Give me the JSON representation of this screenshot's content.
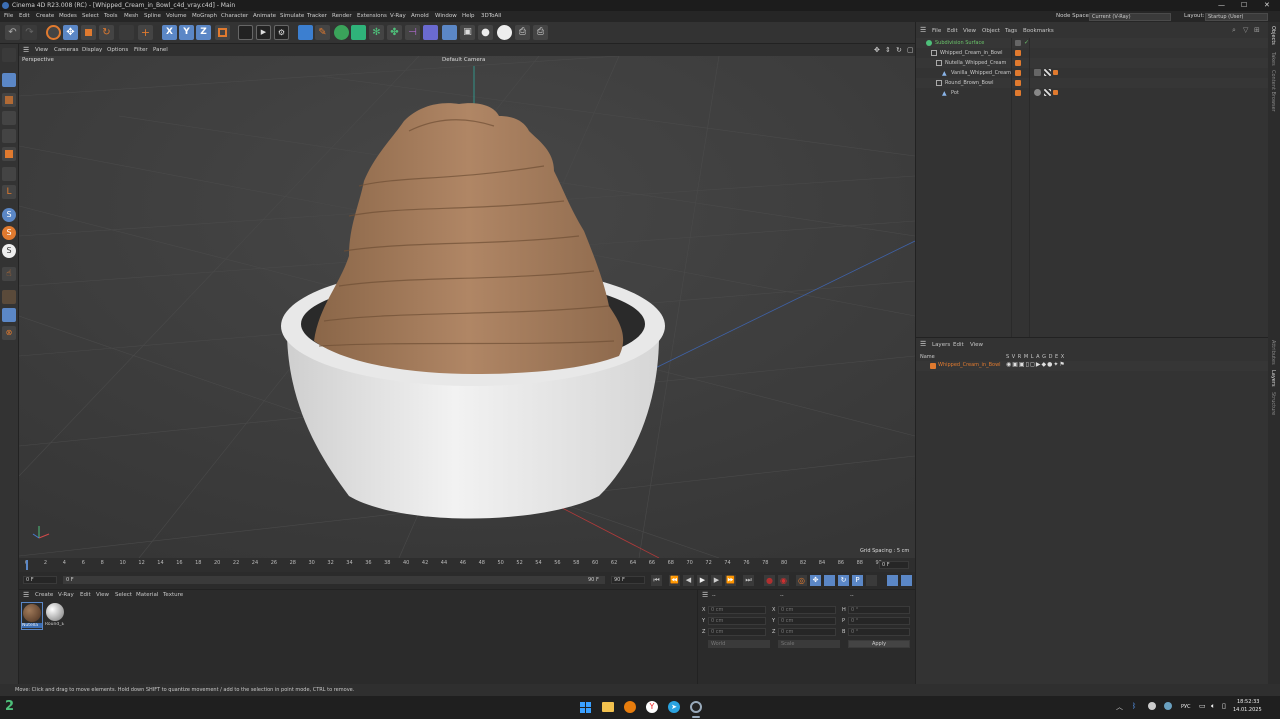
{
  "title_bar": {
    "title": "Cinema 4D R23.008 (RC) - [Whipped_Cream_in_Bowl_c4d_vray.c4d] - Main",
    "min": "—",
    "max": "☐",
    "close": "✕"
  },
  "menu": [
    "File",
    "Edit",
    "Create",
    "Modes",
    "Select",
    "Tools",
    "Mesh",
    "Spline",
    "Volume",
    "MoGraph",
    "Character",
    "Animate",
    "Simulate",
    "Tracker",
    "Render",
    "Extensions",
    "V-Ray",
    "Arnold",
    "Window",
    "Help",
    "3DToAll"
  ],
  "node_space": {
    "label": "Node Space:",
    "value": "Current (V-Ray)"
  },
  "layout": {
    "label": "Layout:",
    "value": "Startup (User)"
  },
  "viewport_menu": [
    "View",
    "Cameras",
    "Display",
    "Options",
    "Filter",
    "Panel"
  ],
  "viewport": {
    "name": "Perspective",
    "camera": "Default Camera",
    "grid_spacing": "Grid Spacing : 5 cm"
  },
  "timeline": {
    "ticks": [
      "0",
      "2",
      "4",
      "6",
      "8",
      "10",
      "12",
      "14",
      "16",
      "18",
      "20",
      "22",
      "24",
      "26",
      "28",
      "30",
      "32",
      "34",
      "36",
      "38",
      "40",
      "42",
      "44",
      "46",
      "48",
      "50",
      "52",
      "54",
      "56",
      "58",
      "60",
      "62",
      "64",
      "66",
      "68",
      "70",
      "72",
      "74",
      "76",
      "78",
      "80",
      "82",
      "84",
      "86",
      "88",
      "90"
    ],
    "current_frame": "0 F"
  },
  "transport": {
    "start": "0 F",
    "preview_start": "0 F",
    "preview_end": "90 F",
    "end": "90 F"
  },
  "material_manager": {
    "menu": [
      "Create",
      "V-Ray",
      "Edit",
      "View",
      "Select",
      "Material",
      "Texture"
    ],
    "materials": [
      {
        "name": "Nutella",
        "color": "#7a5a3e"
      },
      {
        "name": "Round_E",
        "color": "#cfcfcf"
      }
    ]
  },
  "coordinates": {
    "header": "--",
    "header2": "--",
    "header3": "--",
    "rows": [
      {
        "a": "X",
        "av": "0 cm",
        "b": "X",
        "bv": "0 cm",
        "c": "H",
        "cv": "0 °"
      },
      {
        "a": "Y",
        "av": "0 cm",
        "b": "Y",
        "bv": "0 cm",
        "c": "P",
        "cv": "0 °"
      },
      {
        "a": "Z",
        "av": "0 cm",
        "b": "Z",
        "bv": "0 cm",
        "c": "B",
        "cv": "0 °"
      }
    ],
    "mode1": "World",
    "mode2": "Scale",
    "apply": "Apply"
  },
  "status": "Move: Click and drag to move elements. Hold down SHIFT to quantize movement / add to the selection in point mode, CTRL to remove.",
  "object_manager": {
    "menu": [
      "File",
      "Edit",
      "View",
      "Object",
      "Tags",
      "Bookmarks"
    ],
    "objects": [
      {
        "name": "Subdivision Surface",
        "color": "#6ac46a",
        "indent": 0
      },
      {
        "name": "Whipped_Cream_in_Bowl",
        "color": "#cfcfcf",
        "indent": 1
      },
      {
        "name": "Nutella_Whipped_Cream",
        "color": "#cfcfcf",
        "indent": 2
      },
      {
        "name": "Vanilla_Whipped_Cream",
        "color": "#cfcfcf",
        "indent": 3
      },
      {
        "name": "Round_Brown_Bowl",
        "color": "#cfcfcf",
        "indent": 2
      },
      {
        "name": "Pot",
        "color": "#cfcfcf",
        "indent": 3
      }
    ]
  },
  "layer_manager": {
    "menu": [
      "Layers",
      "Edit",
      "View"
    ],
    "col_name": "Name",
    "col_flags": "S V R M L A G D E X",
    "layers": [
      {
        "name": "Whipped_Cream_in_Bowl",
        "color": "#e07a2f"
      }
    ]
  },
  "right_tabs": [
    "Objects",
    "Takes",
    "Content Browser",
    "Attributes",
    "Layers",
    "Structure"
  ],
  "taskbar": {
    "badge": "2",
    "lang": "РУС",
    "time": "18:52:33",
    "date": "14.01.2025"
  },
  "colors": {
    "accent": "#e07a2f",
    "bg": "#2b2b2b",
    "viewport": "#3d3d3d"
  }
}
